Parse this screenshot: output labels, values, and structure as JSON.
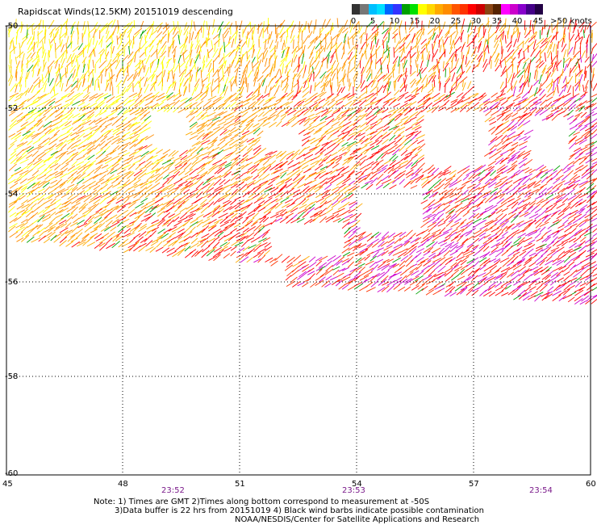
{
  "title": "Rapidscat Winds(12.5KM) 20151019 descending",
  "legend": {
    "ticks": [
      "0",
      "5",
      "10",
      "15",
      "20",
      "25",
      "30",
      "35",
      "40",
      "45",
      ">50 knots"
    ],
    "colors": [
      "#333333",
      "#777777",
      "#00bfff",
      "#00e0ff",
      "#0066ff",
      "#3333ff",
      "#00a000",
      "#00e000",
      "#ffff00",
      "#ffd700",
      "#ffaa00",
      "#ff8c00",
      "#ff5500",
      "#ff3300",
      "#ff0000",
      "#cc0000",
      "#8b4513",
      "#552200",
      "#ff00ff",
      "#cc00cc",
      "#8800cc",
      "#440088",
      "#220044"
    ]
  },
  "axes": {
    "lat_labels": [
      "-50",
      "-52",
      "-54",
      "-56",
      "-58",
      "-60"
    ],
    "lon_labels": [
      "45",
      "48",
      "51",
      "54",
      "57",
      "60"
    ]
  },
  "times": [
    "23:52",
    "23:53",
    "23:54"
  ],
  "notes": [
    "Note: 1) Times are GMT 2)Times along bottom correspond to measurement at -50S",
    "3)Data buffer is 22 hrs from 20151019 4) Black wind barbs indicate possible contamination",
    "NOAA/NESDIS/Center for Satellite Applications and Research"
  ]
}
